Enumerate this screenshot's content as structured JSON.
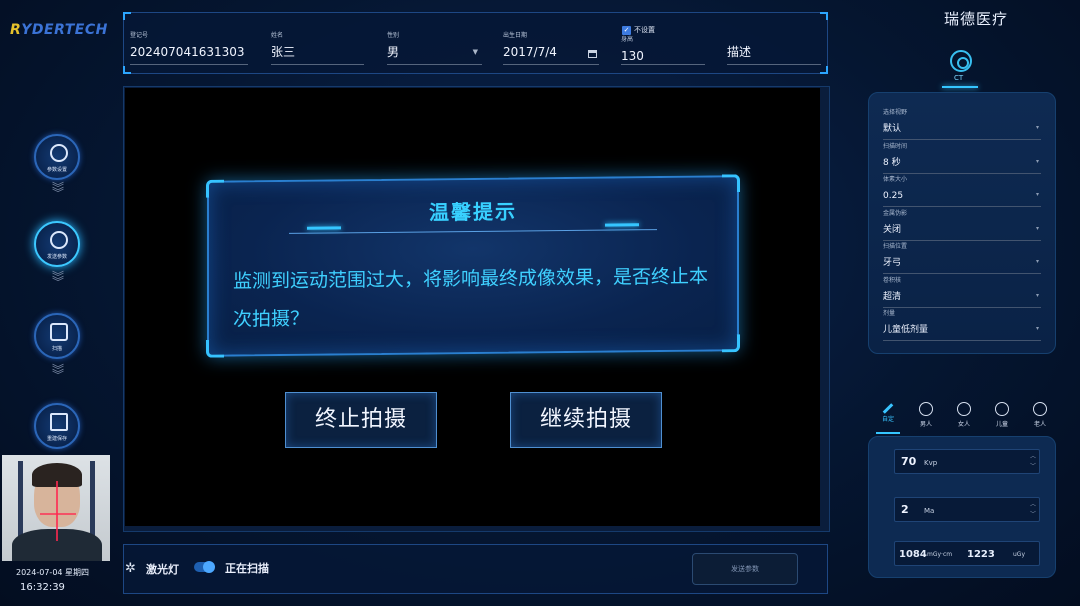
{
  "logo": {
    "prefix": "R",
    "rest": "YDERTECH"
  },
  "brand": "瑞德医疗",
  "patient": {
    "id_label": "登记号",
    "id_value": "202407041631303",
    "name_label": "姓名",
    "name_value": "张三",
    "gender_label": "性别",
    "gender_value": "男",
    "dob_label": "出生日期",
    "dob_value": "2017/7/4",
    "height_label": "身高",
    "height_value": "130",
    "height_check_label": "不设置",
    "desc_value": "描述"
  },
  "nav": [
    {
      "label": "参数设置"
    },
    {
      "label": "发送参数"
    },
    {
      "label": "扫描"
    },
    {
      "label": "重建保存"
    }
  ],
  "camera": {
    "date": "2024-07-04 星期四",
    "time": "16:32:39"
  },
  "modal": {
    "title": "温馨提示",
    "body": "监测到运动范围过大，将影响最终成像效果，是否终止本次拍摄？"
  },
  "buttons": {
    "stop": "终止拍摄",
    "continue": "继续拍摄"
  },
  "bottom": {
    "laser": "激光灯",
    "status": "正在扫描",
    "send": "发送参数"
  },
  "ct": {
    "label": "CT"
  },
  "scan_params": [
    {
      "label": "选择视野",
      "value": "默认"
    },
    {
      "label": "扫描时间",
      "value": "8 秒"
    },
    {
      "label": "体素大小",
      "value": "0.25"
    },
    {
      "label": "金属伪影",
      "value": "关闭"
    },
    {
      "label": "扫描位置",
      "value": "牙弓"
    },
    {
      "label": "卷积核",
      "value": "超清"
    },
    {
      "label": "剂量",
      "value": "儿童低剂量"
    }
  ],
  "person_tabs": [
    {
      "label": "自定",
      "icon": "pencil-icon"
    },
    {
      "label": "男人",
      "icon": "man-head-icon"
    },
    {
      "label": "女人",
      "icon": "woman-head-icon"
    },
    {
      "label": "儿童",
      "icon": "child-head-icon"
    },
    {
      "label": "老人",
      "icon": "elder-head-icon"
    }
  ],
  "exposure": {
    "kvp_value": "70",
    "kvp_unit": "Kvp",
    "ma_value": "2",
    "ma_unit": "Ma",
    "dose_value": "1084",
    "dose_unit": "mGy·cm",
    "udose_value": "1223",
    "udose_unit": "uGy"
  },
  "colors": {
    "accent": "#35c6ff",
    "background": "#04122a",
    "panel": "#0d2a52"
  }
}
